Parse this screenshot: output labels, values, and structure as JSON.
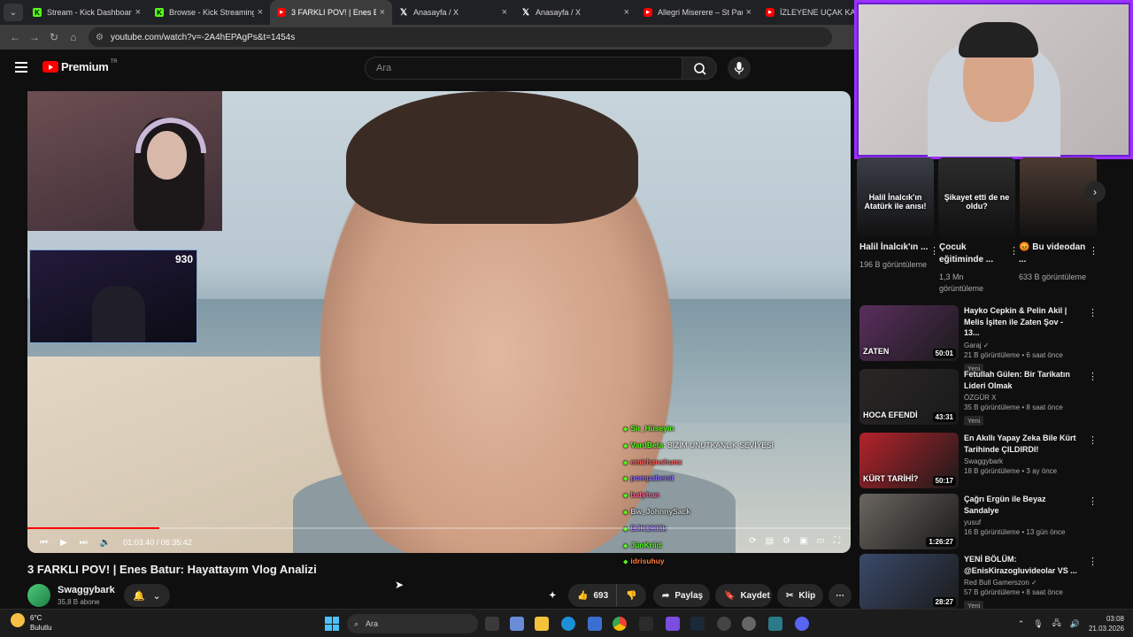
{
  "tabs": [
    {
      "title": "Stream - Kick Dashboard",
      "favicon": "kick-icon"
    },
    {
      "title": "Browse - Kick Streaming",
      "favicon": "kick-icon"
    },
    {
      "title": "3 FARKLI POV! | Enes Batur",
      "favicon": "youtube-icon",
      "active": true
    },
    {
      "title": "Anasayfa / X",
      "favicon": "x-icon"
    },
    {
      "title": "Anasayfa / X",
      "favicon": "x-icon"
    },
    {
      "title": "Allegri Miserere – St Paul's",
      "favicon": "youtube-icon"
    },
    {
      "title": "İZLEYENE UÇAK KALDIR",
      "favicon": "youtube-icon"
    }
  ],
  "address": {
    "url": "youtube.com/watch?v=-2A4hEPAgPs&t=1454s"
  },
  "header": {
    "logo": "Premium",
    "region": "TR",
    "search_placeholder": "Ara"
  },
  "stream_overlay": {
    "viewer_count": "930"
  },
  "chat": [
    {
      "user": "Sir_Hüseyin",
      "msg": "",
      "color": "#53fc18"
    },
    {
      "user": "VardBeta",
      "msg": ": BİZİM UNUTKANLIK SEVİYESİ",
      "color": "#53fc18"
    },
    {
      "user": "emirhanshunx",
      "msg": "",
      "color": "#ff5f5f"
    },
    {
      "user": "pompaberst",
      "msg": "",
      "color": "#8c6cff"
    },
    {
      "user": "batyhan",
      "msg": "",
      "color": "#ff5f8f"
    },
    {
      "user": "Bw_JohnnySack",
      "msg": "",
      "color": "#cfcfcf"
    },
    {
      "user": "BJK1903k",
      "msg": "",
      "color": "#9a7cff"
    },
    {
      "user": "JünKriid",
      "msg": ":",
      "color": "#53fc18"
    },
    {
      "user": "idrisuhuy",
      "msg": "",
      "color": "#ff7b3a"
    }
  ],
  "player": {
    "time": "01:03:40 / 06:35:42",
    "progress": 0.16
  },
  "video": {
    "title": "3 FARKLI POV! | Enes Batur: Hayattayım Vlog Analizi"
  },
  "channel": {
    "name": "Swaggybark",
    "subs": "35,8 B abone"
  },
  "actions": {
    "likes": "693",
    "share": "Paylaş",
    "save": "Kaydet",
    "clip": "Klip"
  },
  "shorts": [
    {
      "caption": "Halil İnalcık'ın Atatürk ile anısı!",
      "title": "Halil İnalcık'ın ...",
      "views": "196 B görüntüleme",
      "color": "#3b3e48"
    },
    {
      "caption": "Şikayet etti de ne oldu?",
      "title": "Çocuk eğitiminde ...",
      "views": "1,3 Mn görüntüleme",
      "color": "#2c2c2c"
    },
    {
      "caption": "",
      "title": "😡 Bu videodan ...",
      "views": "633 B görüntüleme",
      "color": "#4c3a32"
    }
  ],
  "recommended": [
    {
      "title": "Hayko Cepkin & Pelin Akil | Melis İşiten ile Zaten Şov - 13...",
      "channel": "Garaj ✓",
      "stats": "21 B görüntüleme • 6 saat önce",
      "badge": "Yeni",
      "duration": "50:01",
      "thumb_text": "ZATEN",
      "color": "#5a2e5e"
    },
    {
      "title": "Fetullah Gülen: Bir Tarikatın Lideri Olmak",
      "channel": "ÖZGÜR X",
      "stats": "35 B görüntüleme • 8 saat önce",
      "badge": "Yeni",
      "duration": "43:31",
      "thumb_text": "HOCA EFENDİ",
      "color": "#2a2626"
    },
    {
      "title": "En Akıllı Yapay Zeka Bile Kürt Tarihinde ÇILDIRDI!",
      "channel": "Swaggybark",
      "stats": "18 B görüntüleme • 3 ay önce",
      "badge": "",
      "duration": "50:17",
      "thumb_text": "KÜRT TARİHİ?",
      "color": "#b5232b"
    },
    {
      "title": "Çağrı Ergün ile Beyaz Sandalye",
      "channel": "yusuf",
      "stats": "16 B görüntüleme • 13 gün önce",
      "badge": "",
      "duration": "1:26:27",
      "thumb_text": "",
      "color": "#6b6660"
    },
    {
      "title": "YENİ BÖLÜM: @EnisKirazogluvideolar VS ...",
      "channel": "Red Bull Gamerszon ✓",
      "stats": "57 B görüntüleme • 8 saat önce",
      "badge": "Yeni",
      "duration": "28:27",
      "thumb_text": "",
      "color": "#3a4a6a"
    }
  ],
  "taskbar": {
    "temp": "6°C",
    "weather": "Bulutlu",
    "search": "Ara",
    "time": "03:08",
    "date": "21.03.2026"
  }
}
